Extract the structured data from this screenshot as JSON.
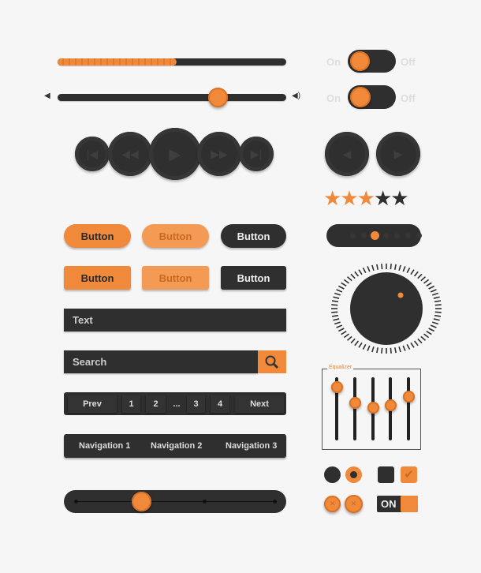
{
  "colors": {
    "accent": "#f0893a",
    "dark": "#2f2f2f",
    "background": "#f6f6f6"
  },
  "progress": {
    "percent": 52
  },
  "volume": {
    "percent": 70,
    "low_icon": "speaker-low-icon",
    "high_icon": "speaker-high-icon"
  },
  "toggles": [
    {
      "on_label": "On",
      "off_label": "Off",
      "state": "on"
    },
    {
      "on_label": "On",
      "off_label": "Off",
      "state": "on"
    }
  ],
  "media": {
    "buttons": [
      "skip-back-icon",
      "rewind-icon",
      "play-icon",
      "forward-icon",
      "skip-forward-icon"
    ],
    "nav": [
      "previous-icon",
      "next-icon"
    ]
  },
  "rating": {
    "value": 3,
    "max": 5
  },
  "buttons": {
    "row1": [
      "Button",
      "Button",
      "Button"
    ],
    "row2": [
      "Button",
      "Button",
      "Button"
    ]
  },
  "dot_slider": {
    "position": 2,
    "steps": 7
  },
  "text_field": {
    "value": "Text"
  },
  "search": {
    "placeholder": "Search",
    "icon": "search-icon"
  },
  "pagination": {
    "prev": "Prev",
    "pages": [
      "1",
      "2",
      "...",
      "3",
      "4"
    ],
    "next": "Next"
  },
  "navigation": [
    "Navigation 1",
    "Navigation 2",
    "Navigation 3"
  ],
  "range_slider": {
    "percent": 33
  },
  "equalizer": {
    "title": "Equalizer",
    "levels": [
      85,
      60,
      52,
      56,
      70
    ]
  },
  "toggle_on": {
    "label": "ON"
  }
}
